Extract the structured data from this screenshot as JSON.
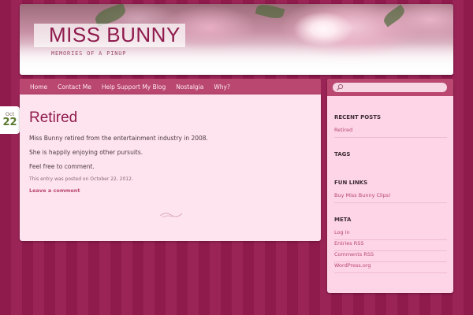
{
  "site": {
    "title": "MISS BUNNY",
    "description": "MEMORIES OF A PINUP"
  },
  "nav": {
    "items": [
      "Home",
      "Contact Me",
      "Help Support My Blog",
      "Nostalgia",
      "Why?"
    ]
  },
  "post": {
    "date_month": "Oct",
    "date_day": "22",
    "title": "Retired",
    "paragraphs": [
      "Miss Bunny retired from the entertainment industry in 2008.",
      "She is happily enjoying other pursuits.",
      "Feel free to comment."
    ],
    "meta": "This entry was posted on October 22, 2012.",
    "comment_link": "Leave a comment"
  },
  "sidebar": {
    "search_placeholder": "",
    "recent_posts": {
      "title": "RECENT POSTS",
      "items": [
        "Retired"
      ]
    },
    "tags": {
      "title": "TAGS"
    },
    "fun_links": {
      "title": "FUN LINKS",
      "items": [
        "Buy Miss Bunny Clips!"
      ]
    },
    "meta": {
      "title": "META",
      "items": [
        "Log in",
        "Entries RSS",
        "Comments RSS",
        "WordPress.org"
      ]
    }
  },
  "colors": {
    "background": "#8f1b4c",
    "accent": "#b9476f",
    "content_bg": "#fee4ef",
    "sidebar_bg": "#fdd5e6",
    "date_day": "#5b7a2f"
  }
}
